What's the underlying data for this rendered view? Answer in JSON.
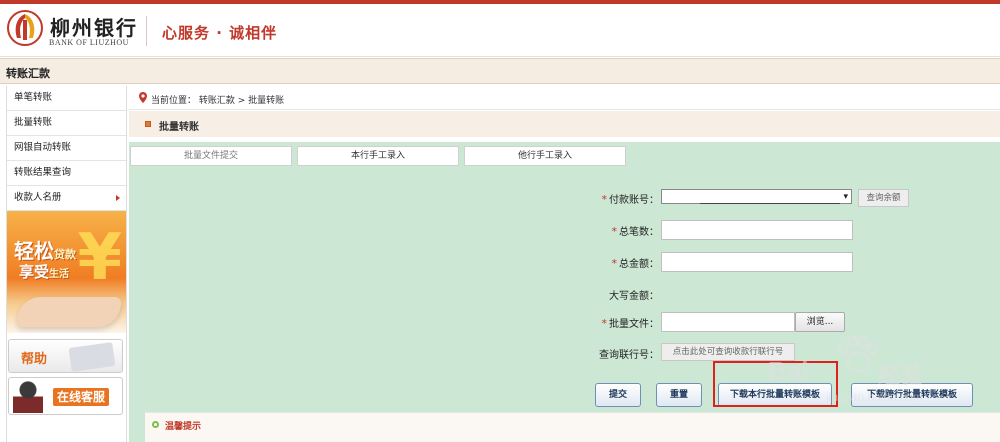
{
  "header": {
    "brand_cn": "柳州银行",
    "brand_en": "BANK OF LIUZHOU",
    "slogan": "心服务 · 诚相伴",
    "accent_color": "#c0392b"
  },
  "section": {
    "title": "转账汇款"
  },
  "sidebar": {
    "items": [
      {
        "label": "单笔转账"
      },
      {
        "label": "批量转账"
      },
      {
        "label": "网银自动转账"
      },
      {
        "label": "转账结果查询"
      },
      {
        "label": "收款人名册",
        "has_submenu": true
      }
    ],
    "promo": {
      "line1_big": "轻松",
      "line1_small": "贷款",
      "line2_big": "享受",
      "line2_small": "生活",
      "symbol": "¥"
    },
    "help_label": "帮助",
    "service_label": "在线客服"
  },
  "breadcrumb": {
    "text": "当前位置： 转账汇款 > 批量转账",
    "icon": "location-pin-icon"
  },
  "page_title": "批量转账",
  "tabs": [
    {
      "label": "批量文件提交",
      "active": true
    },
    {
      "label": "本行手工录入",
      "active": false
    },
    {
      "label": "他行手工录入",
      "active": false
    }
  ],
  "form": {
    "account_label": "付款账号：",
    "account_value": "",
    "query_balance_label": "查询余额",
    "total_count_label": "总笔数：",
    "total_count_value": "",
    "total_amount_label": "总金额：",
    "total_amount_value": "",
    "uppercase_amount_label": "大写金额：",
    "batch_file_label": "批量文件：",
    "batch_file_value": "",
    "browse_label": "浏览...",
    "query_bank_label": "查询联行号：",
    "query_bank_button": "点击此处可查询收款行联行号"
  },
  "actions": {
    "submit": "提交",
    "reset": "重置",
    "download_own": "下载本行批量转账模板",
    "download_other": "下载跨行批量转账模板"
  },
  "tips_title": "温馨提示",
  "watermark": {
    "brand": "Bai",
    "brand_cn": "经验",
    "url": "jingyan.baidu.com"
  }
}
